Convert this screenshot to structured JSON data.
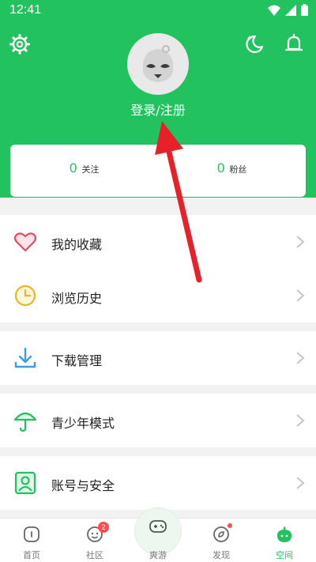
{
  "status": {
    "time": "12:41"
  },
  "header": {
    "login_label": "登录/注册"
  },
  "stats": [
    {
      "value": "0",
      "label": "关注"
    },
    {
      "value": "0",
      "label": "粉丝"
    }
  ],
  "menu": [
    {
      "label": "我的收藏",
      "icon": "heart-icon"
    },
    {
      "label": "浏览历史",
      "icon": "clock-icon"
    },
    {
      "label": "下载管理",
      "icon": "download-icon"
    },
    {
      "label": "青少年模式",
      "icon": "umbrella-icon"
    },
    {
      "label": "账号与安全",
      "icon": "account-security-icon"
    }
  ],
  "tabs": [
    {
      "label": "首页",
      "icon": "home-icon"
    },
    {
      "label": "社区",
      "icon": "community-icon",
      "badge": "2"
    },
    {
      "label": "爽游",
      "icon": "gamepad-icon"
    },
    {
      "label": "发现",
      "icon": "discover-icon"
    },
    {
      "label": "空间",
      "icon": "space-icon",
      "active": true
    }
  ],
  "colors": {
    "brand": "#22c35e",
    "badge": "#ff4d4f",
    "annotation_arrow": "#e8202a"
  }
}
